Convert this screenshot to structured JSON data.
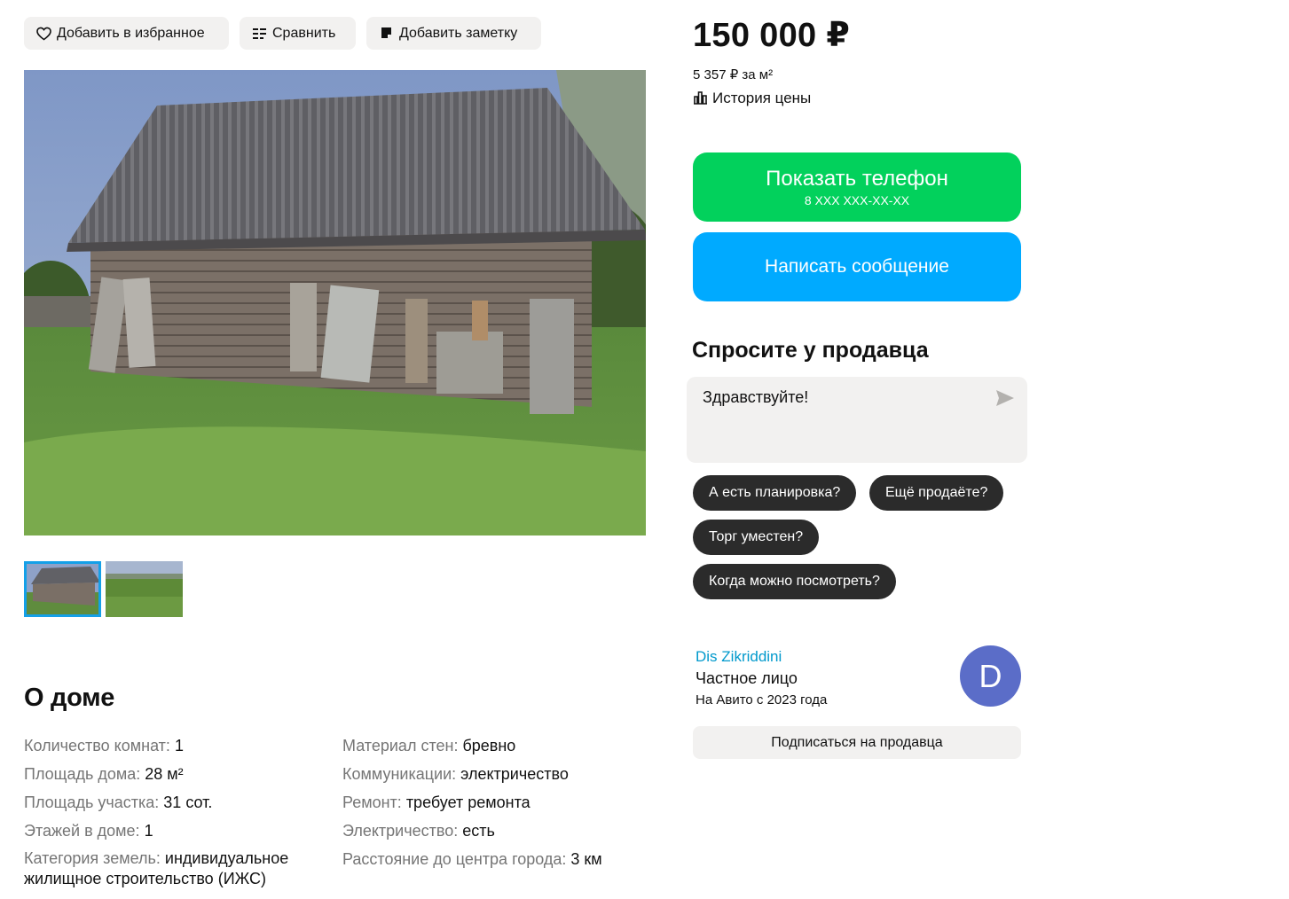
{
  "actions": {
    "favorite": "Добавить в избранное",
    "compare": "Сравнить",
    "note": "Добавить заметку"
  },
  "gallery": {
    "main_image": "photo-old-wooden-house",
    "thumbnails": [
      "photo-old-wooden-house",
      "photo-field"
    ],
    "active_index": 0
  },
  "about": {
    "title": "О доме",
    "left": [
      {
        "key": "Количество комнат:",
        "value": "1"
      },
      {
        "key": "Площадь дома:",
        "value": "28 м²"
      },
      {
        "key": "Площадь участка:",
        "value": "31 сот."
      },
      {
        "key": "Этажей в доме:",
        "value": "1"
      },
      {
        "key": "Категория земель:",
        "value": "индивидуальное жилищное строительство (ИЖС)"
      }
    ],
    "right": [
      {
        "key": "Материал стен:",
        "value": "бревно"
      },
      {
        "key": "Коммуникации:",
        "value": "электричество"
      },
      {
        "key": "Ремонт:",
        "value": "требует ремонта"
      },
      {
        "key": "Электричество:",
        "value": "есть"
      },
      {
        "key": "Расстояние до центра города:",
        "value": "3 км"
      }
    ]
  },
  "price": {
    "value": "150 000 ₽",
    "per_m2": "5 357 ₽ за м²",
    "history": "История цены"
  },
  "contact": {
    "phone_label": "Показать телефон",
    "phone_mask": "8 XXX XXX-XX-XX",
    "message_label": "Написать сообщение"
  },
  "ask": {
    "title": "Спросите у продавца",
    "input_value": "Здравствуйте!",
    "chips": [
      "А есть планировка?",
      "Ещё продаёте?",
      "Торг уместен?",
      "Когда можно посмотреть?"
    ]
  },
  "seller": {
    "name": "Dis Zikriddini",
    "type": "Частное лицо",
    "since": "На Авито с 2023 года",
    "avatar_letter": "D",
    "subscribe_label": "Подписаться на продавца"
  },
  "colors": {
    "phone_button": "#02d15c",
    "message_button": "#00aaff",
    "chip": "#2b2b2b",
    "avatar": "#5b6dc8",
    "seller_link": "#0099cc",
    "thumb_active": "#14a0e8"
  }
}
